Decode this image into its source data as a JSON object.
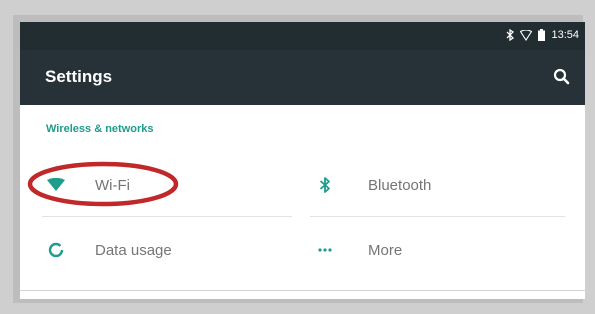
{
  "status_bar": {
    "time": "13:54",
    "icons": [
      "bluetooth-icon",
      "wifi-signal-icon",
      "battery-icon"
    ]
  },
  "app_bar": {
    "title": "Settings",
    "search_icon": "search-icon"
  },
  "section": {
    "header": "Wireless & networks"
  },
  "tiles": [
    {
      "label": "Wi-Fi",
      "icon": "wifi-icon",
      "highlighted": true
    },
    {
      "label": "Bluetooth",
      "icon": "bluetooth-icon"
    },
    {
      "label": "Data usage",
      "icon": "data-usage-icon"
    },
    {
      "label": "More",
      "icon": "more-icon"
    }
  ],
  "colors": {
    "status_bar": "#222d31",
    "app_bar": "#263238",
    "accent": "#1e9d8a",
    "highlight_ring": "#c0282a"
  }
}
